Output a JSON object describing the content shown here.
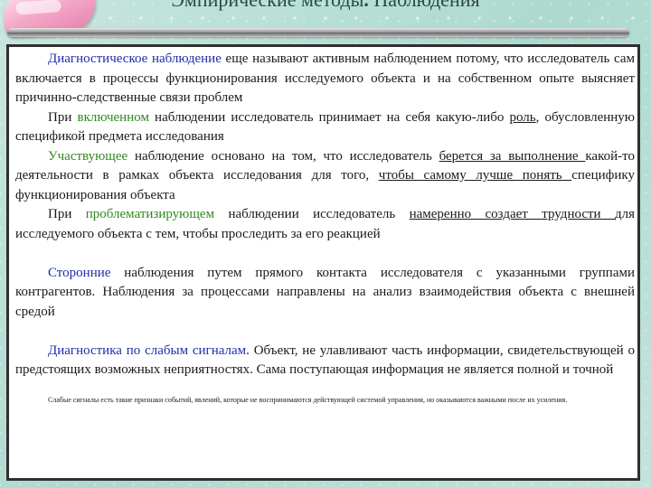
{
  "slide": {
    "title_main": "Эмпирические методы",
    "title_dot": ".",
    "title_rest": " Наблюдения"
  },
  "paragraphs": {
    "p1": {
      "term": "Диагностическое наблюдение",
      "text": " еще называют активным наблюдением потому, что исследователь сам включается в процессы функционирования исследуемого объекта и на собственном опыте выясняет причинно-следственные связи проблем"
    },
    "p2": {
      "lead": "При ",
      "term": "включенном",
      "mid": " наблюдении исследователь принимает на себя какую-либо ",
      "underlined": "роль",
      "tail": ", обусловленную спецификой предмета исследования"
    },
    "p3": {
      "term": "Участвующее",
      "mid": " наблюдение основано на том, что исследователь ",
      "underlined1": "берется за выполнение ",
      "mid2": "какой-то деятельности в рамках объекта исследования для того, ",
      "underlined2": "чтобы самому лучше понять ",
      "tail": "специфику функционирования объекта"
    },
    "p4": {
      "lead": "При ",
      "term": "проблематизирующем",
      "mid": " наблюдении исследователь ",
      "underlined": "намеренно создает трудности ",
      "tail": "для исследуемого объекта с тем, чтобы проследить за его реакцией"
    },
    "p5": {
      "term": "Сторонние",
      "text": " наблюдения путем прямого контакта исследователя с указанными группами контрагентов. Наблюдения за процессами направлены на анализ взаимодействия объекта с внешней средой"
    },
    "p6": {
      "term": "Диагностика по слабым сигналам",
      "text": ". Объект, не улавливают часть информации, свидетельствующей о предстоящих возможных неприятностях. Сама поступающая информация не является полной и точной"
    },
    "footnote": "Слабые сигналы есть такие признаки событий, явлений, которые не воспринимаются действующей системой управления, но оказываются важными после их усиления."
  }
}
